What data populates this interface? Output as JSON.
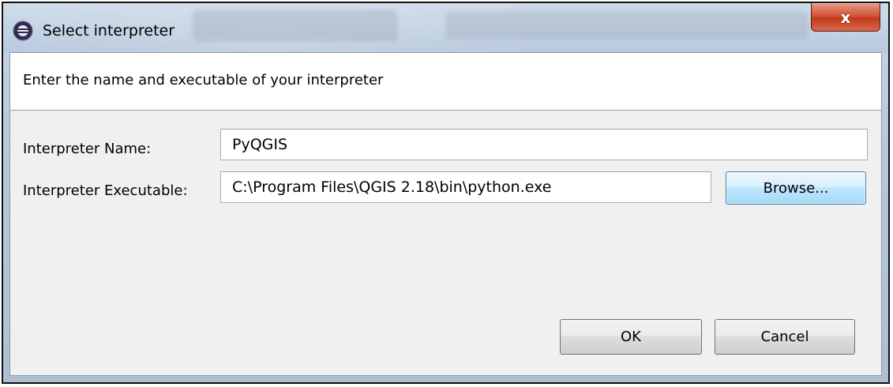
{
  "window": {
    "title": "Select interpreter",
    "close_glyph": "x"
  },
  "dialog": {
    "description": "Enter the name and executable of your interpreter",
    "interpreter_name_label": "Interpreter Name:",
    "interpreter_name_value": "PyQGIS",
    "interpreter_executable_label": "Interpreter Executable:",
    "interpreter_executable_value": "C:\\Program Files\\QGIS 2.18\\bin\\python.exe",
    "browse_label": "Browse...",
    "ok_label": "OK",
    "cancel_label": "Cancel"
  },
  "icons": {
    "app": "eclipse-app-icon",
    "close": "close-icon"
  },
  "colors": {
    "close_button": "#c9432a",
    "browse_focus_border": "#3c7fb1",
    "dialog_background": "#f0f0f0"
  }
}
